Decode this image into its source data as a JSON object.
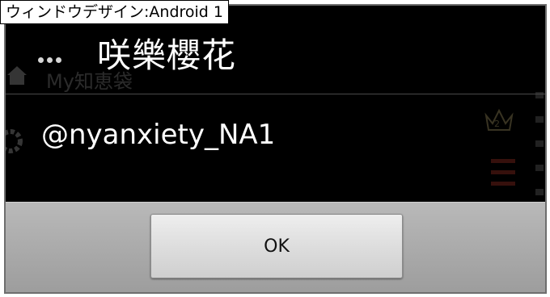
{
  "caption": "ウィンドウデザイン:Android 1",
  "background_app": {
    "list_title": "My知恵袋"
  },
  "dialog": {
    "title": "咲樂櫻花",
    "message": "@nyanxiety_NA1",
    "ok_label": "OK"
  },
  "icons": {
    "overflow": "overflow-menu-icon",
    "home": "home-icon",
    "settings": "gear-icon",
    "rank": "crown-icon"
  },
  "colors": {
    "dialog_background": "#000000",
    "button_bar": "#a8a8a8",
    "button_face": "#dcdcdc",
    "title_text": "#ffffff"
  }
}
